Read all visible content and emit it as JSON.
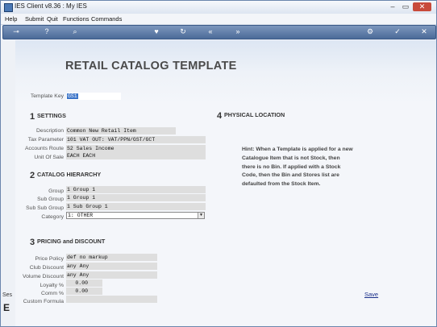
{
  "window": {
    "title": "IES Client v8.36 : My IES"
  },
  "menubar": {
    "items": [
      "Help",
      "Submit",
      "Quit",
      "Functions",
      "Commands"
    ]
  },
  "toolbar": {
    "icons": [
      {
        "name": "key-icon",
        "glyph": "⊸"
      },
      {
        "name": "help-icon",
        "glyph": "?"
      },
      {
        "name": "search-icon",
        "glyph": "⌕"
      },
      {
        "name": "heart-icon",
        "glyph": "♥"
      },
      {
        "name": "refresh-icon",
        "glyph": "↻"
      },
      {
        "name": "back-icon",
        "glyph": "«"
      },
      {
        "name": "forward-icon",
        "glyph": "»"
      },
      {
        "name": "gear-icon",
        "glyph": "⚙"
      },
      {
        "name": "check-icon",
        "glyph": "✓"
      },
      {
        "name": "close-icon",
        "glyph": "✕"
      }
    ]
  },
  "sidebar": {
    "label": "Ses",
    "big": "E"
  },
  "page": {
    "title": "RETAIL CATALOG TEMPLATE"
  },
  "template_key": {
    "label": "Template Key",
    "value": "GS1"
  },
  "settings": {
    "number": "1",
    "title": "SETTINGS",
    "fields": [
      {
        "label": "Description",
        "value": "Common New Retail Item"
      },
      {
        "label": "Tax Parameter",
        "value": "101 VAT OUT: VAT/PPN/GST/GCT"
      },
      {
        "label": "Accounts Route",
        "value": "S2 Sales Income"
      },
      {
        "label": "Unit Of Sale",
        "value": "EACH EACH"
      }
    ]
  },
  "hierarchy": {
    "number": "2",
    "title": "CATALOG HIERARCHY",
    "fields": [
      {
        "label": "Group",
        "value": "1 Group 1"
      },
      {
        "label": "Sub Group",
        "value": "1 Group 1"
      },
      {
        "label": "Sub Sub Group",
        "value": "1 Sub Group 1"
      }
    ],
    "category": {
      "label": "Category",
      "value": "1: OTHER"
    }
  },
  "pricing": {
    "number": "3",
    "title": "PRICING and DISCOUNT",
    "fields": [
      {
        "label": "Price Policy",
        "value": "def no markup"
      },
      {
        "label": "Club Discount",
        "value": "any Any"
      },
      {
        "label": "Volume Discount",
        "value": "any Any"
      },
      {
        "label": "Loyalty %",
        "value": "0.00"
      },
      {
        "label": "Comm %",
        "value": "0.00"
      },
      {
        "label": "Custom Formula",
        "value": ""
      }
    ]
  },
  "physical": {
    "number": "4",
    "title": "PHYSICAL LOCATION",
    "hint": "Hint: When a Template is applied for a new Catalogue Item that is not Stock, then there is no Bin. If applied with a Stock Code, then the Bin and Stores list are defaulted from the Stock Item."
  },
  "actions": {
    "save_label": "Save"
  }
}
